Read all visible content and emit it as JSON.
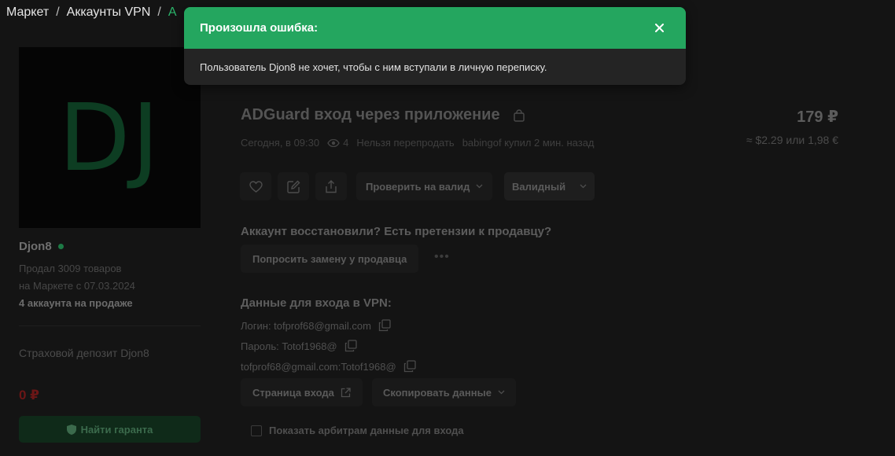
{
  "breadcrumb": {
    "items": [
      "Маркет",
      "Аккаунты VPN"
    ],
    "separator": "/",
    "current": "А"
  },
  "seller": {
    "avatar_initials": "DJ",
    "name": "Djon8",
    "sold": "Продал 3009 товаров",
    "since": "на Маркете с 07.03.2024",
    "accounts": "4 аккаунта на продаже",
    "deposit_label": "Страховой депозит Djon8",
    "deposit_value": "0 ₽",
    "guarantor_button": "Найти гаранта"
  },
  "listing": {
    "title": "ADGuard вход через приложение",
    "price": "179 ₽",
    "price_converted": "≈ $2.29 или 1,98 €",
    "date": "Сегодня, в 09:30",
    "views": "4",
    "resale": "Нельзя перепродать",
    "buyer": "babingof купил 2 мин. назад"
  },
  "actions": {
    "check_valid": "Проверить на валид",
    "status": "Валидный"
  },
  "claim": {
    "question": "Аккаунт восстановили? Есть претензии к продавцу?",
    "replace_button": "Попросить замену у продавца",
    "more": "•••"
  },
  "credentials": {
    "heading": "Данные для входа в VPN:",
    "login": "Логин: tofprof68@gmail.com",
    "password": "Пароль: Totof1968@",
    "combined": "tofprof68@gmail.com:Totof1968@",
    "login_page_button": "Страница входа",
    "copy_button": "Скопировать данные",
    "show_arbiters": "Показать арбитрам данные для входа"
  },
  "modal": {
    "title": "Произошла ошибка:",
    "message": "Пользователь Djon8 не хочет, чтобы с ним вступали в личную переписку."
  },
  "colors": {
    "accent": "#24a65f",
    "background": "#141414",
    "danger": "#6b1616"
  }
}
